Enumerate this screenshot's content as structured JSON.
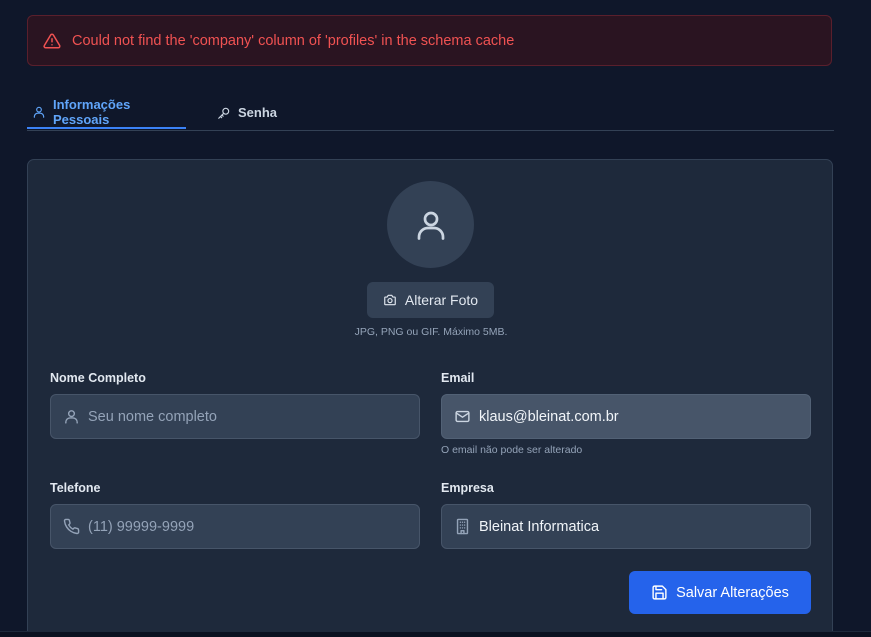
{
  "alert": {
    "message": "Could not find the 'company' column of 'profiles' in the schema cache",
    "icon": "warning-triangle-icon",
    "color": "#f05252"
  },
  "tabs": [
    {
      "label": "Informações Pessoais",
      "icon": "user-icon",
      "active": true
    },
    {
      "label": "Senha",
      "icon": "key-icon",
      "active": false
    }
  ],
  "profile": {
    "avatar_icon": "user-icon",
    "change_photo_label": "Alterar Foto",
    "photo_hint": "JPG, PNG ou GIF. Máximo 5MB."
  },
  "form": {
    "name": {
      "label": "Nome Completo",
      "placeholder": "Seu nome completo",
      "value": "",
      "icon": "user-icon"
    },
    "email": {
      "label": "Email",
      "value": "klaus@bleinat.com.br",
      "helper": "O email não pode ser alterado",
      "icon": "mail-icon"
    },
    "phone": {
      "label": "Telefone",
      "placeholder": "(11) 99999-9999",
      "value": "",
      "icon": "phone-icon"
    },
    "company": {
      "label": "Empresa",
      "value": "Bleinat Informatica",
      "icon": "building-icon"
    }
  },
  "actions": {
    "save_label": "Salvar Alterações",
    "accent": "#2563eb"
  }
}
